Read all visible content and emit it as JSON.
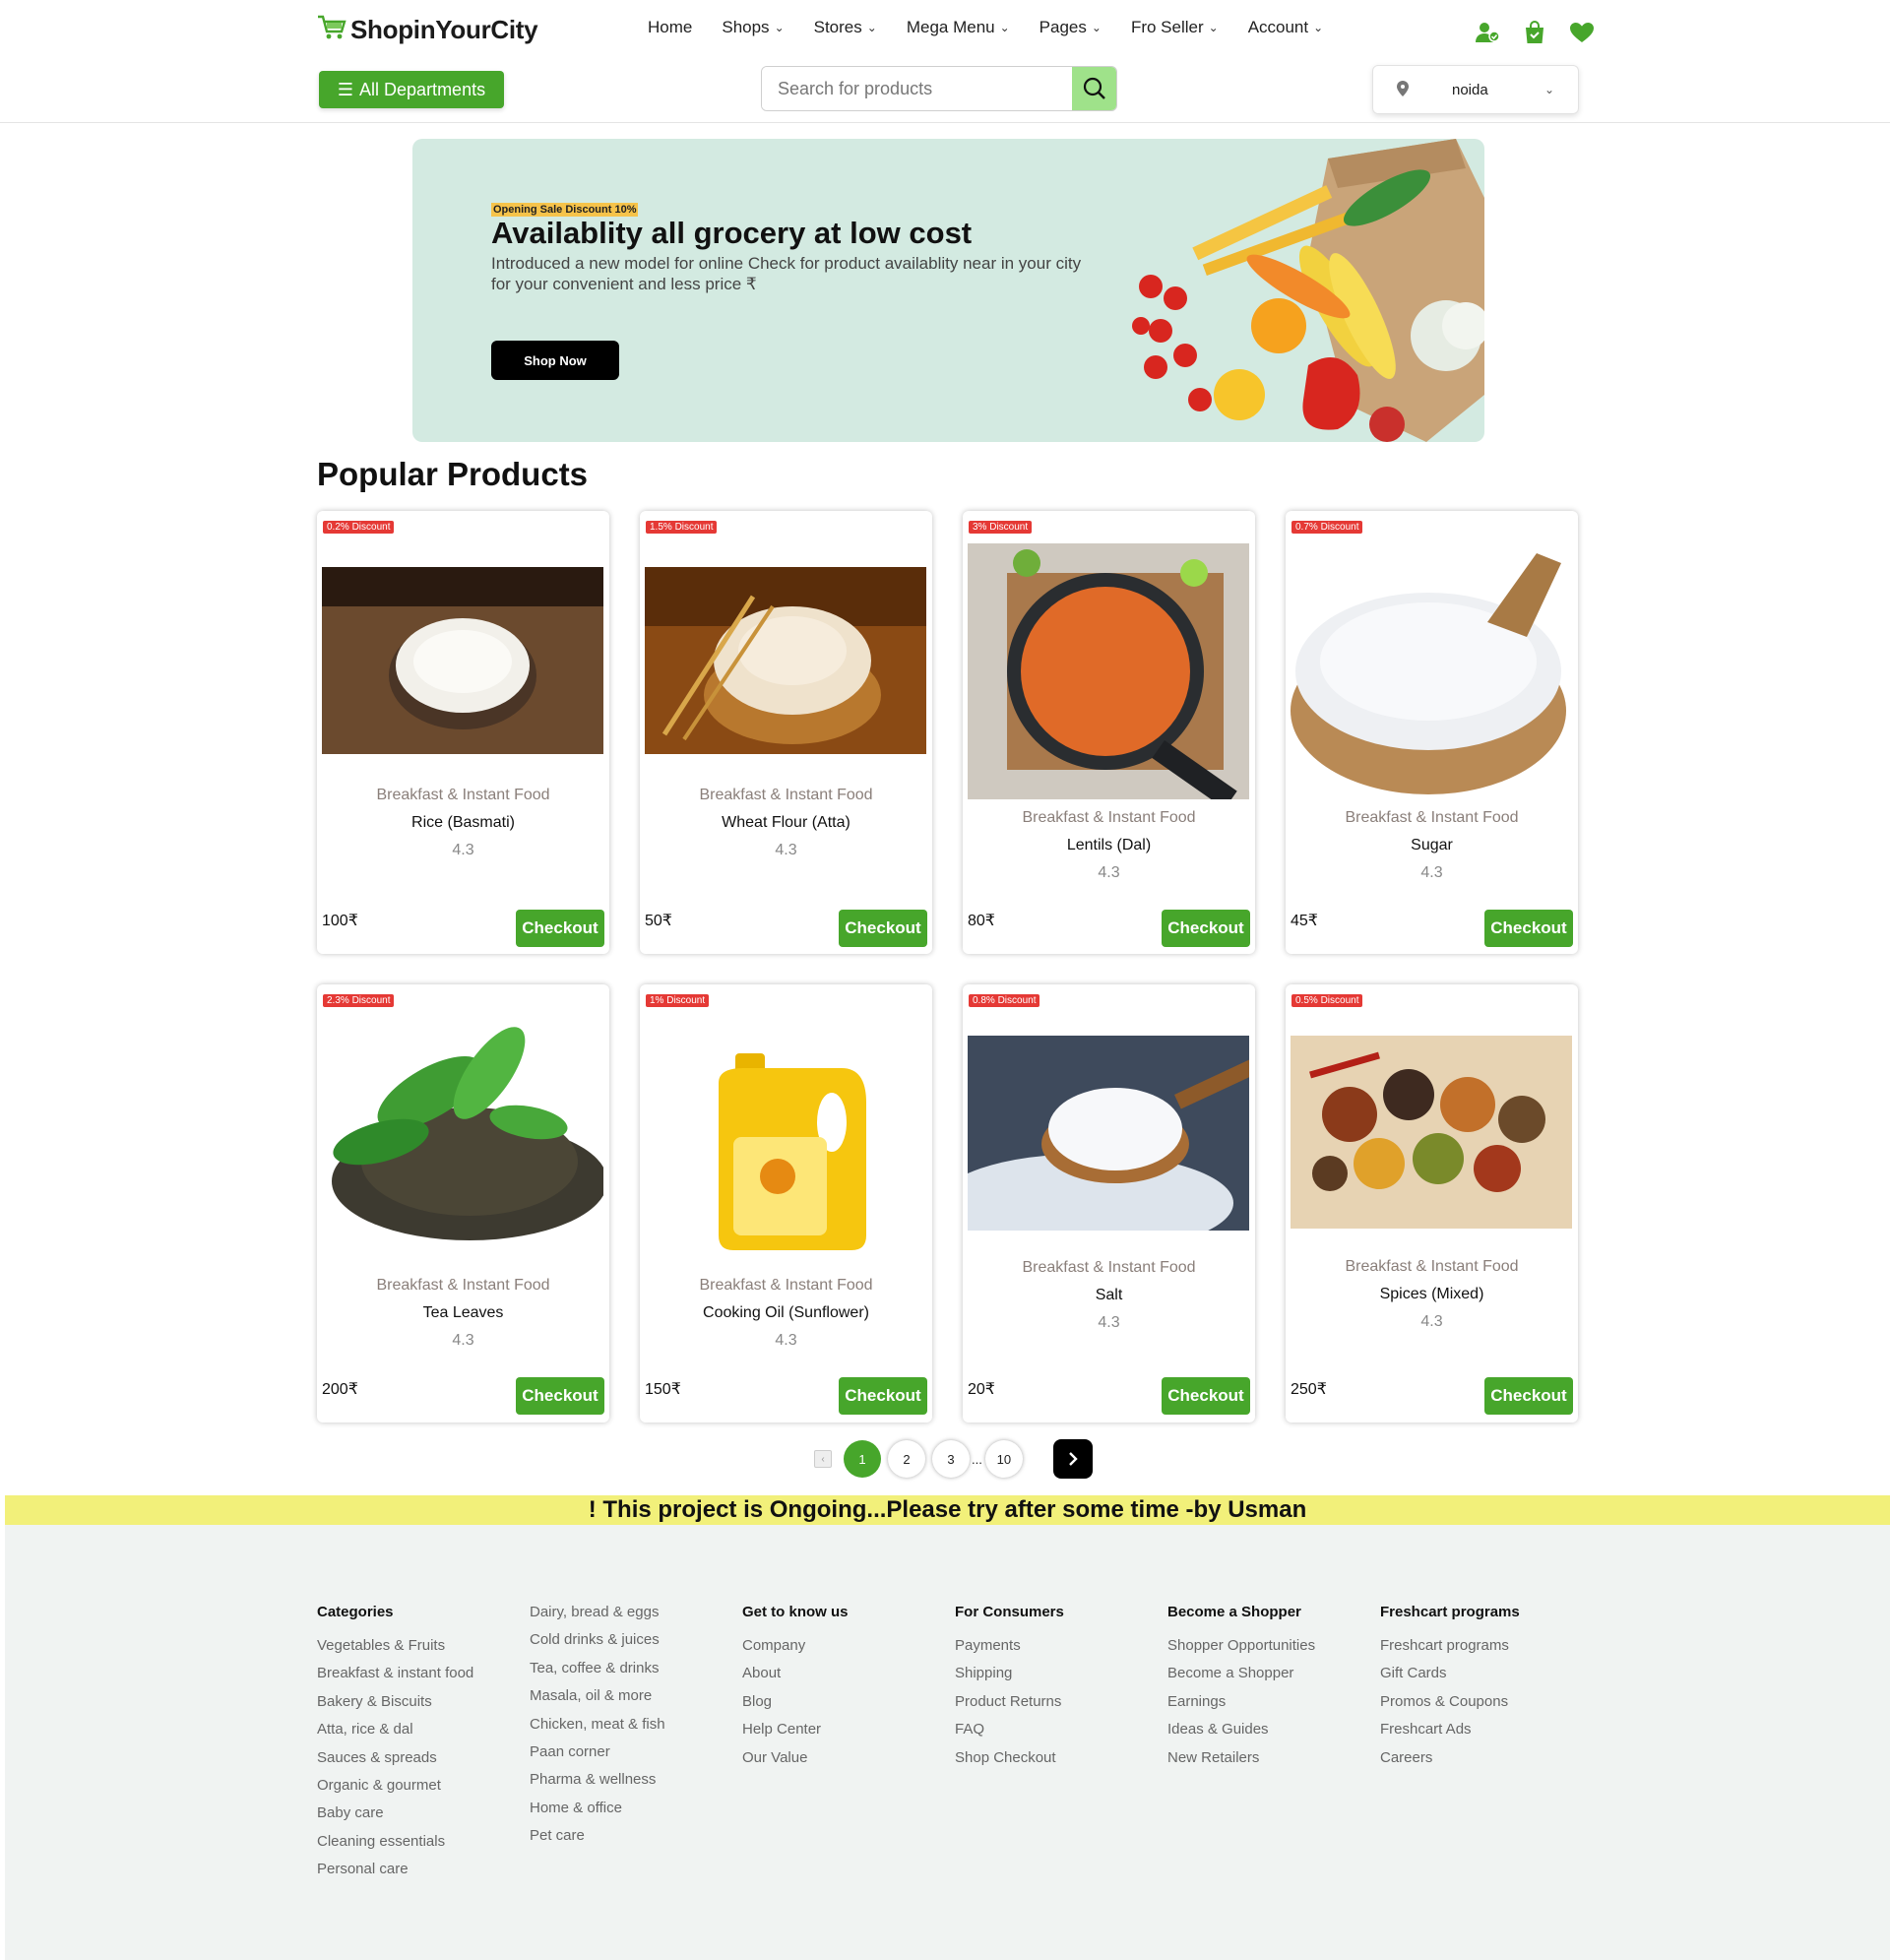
{
  "header": {
    "logo_text": "ShopinYourCity",
    "nav": [
      {
        "label": "Home",
        "has_dropdown": false
      },
      {
        "label": "Shops",
        "has_dropdown": true
      },
      {
        "label": "Stores",
        "has_dropdown": true
      },
      {
        "label": "Mega Menu",
        "has_dropdown": true
      },
      {
        "label": "Pages",
        "has_dropdown": true
      },
      {
        "label": "Fro Seller",
        "has_dropdown": true
      },
      {
        "label": "Account",
        "has_dropdown": true
      }
    ],
    "icons": [
      "user-icon",
      "shopping-bag-icon",
      "heart-icon"
    ],
    "departments_label": "All Departments",
    "search_placeholder": "Search for products",
    "location": "noida"
  },
  "banner": {
    "tag": "Opening Sale Discount 10%",
    "title": "Availablity all grocery at low cost",
    "description": "Introduced a new model for online Check for product availablity near in your city for your convenient and less price ₹",
    "button": "Shop Now"
  },
  "popular": {
    "title": "Popular Products",
    "checkout_label": "Checkout",
    "products": [
      {
        "discount": "0.2% Discount",
        "category": "Breakfast & Instant Food",
        "name": "Rice (Basmati)",
        "rating": "4.3",
        "price": "100₹"
      },
      {
        "discount": "1.5% Discount",
        "category": "Breakfast & Instant Food",
        "name": "Wheat Flour (Atta)",
        "rating": "4.3",
        "price": "50₹"
      },
      {
        "discount": "3% Discount",
        "category": "Breakfast & Instant Food",
        "name": "Lentils (Dal)",
        "rating": "4.3",
        "price": "80₹"
      },
      {
        "discount": "0.7% Discount",
        "category": "Breakfast & Instant Food",
        "name": "Sugar",
        "rating": "4.3",
        "price": "45₹"
      },
      {
        "discount": "2.3% Discount",
        "category": "Breakfast & Instant Food",
        "name": "Tea Leaves",
        "rating": "4.3",
        "price": "200₹"
      },
      {
        "discount": "1% Discount",
        "category": "Breakfast & Instant Food",
        "name": "Cooking Oil (Sunflower)",
        "rating": "4.3",
        "price": "150₹"
      },
      {
        "discount": "0.8% Discount",
        "category": "Breakfast & Instant Food",
        "name": "Salt",
        "rating": "4.3",
        "price": "20₹"
      },
      {
        "discount": "0.5% Discount",
        "category": "Breakfast & Instant Food",
        "name": "Spices (Mixed)",
        "rating": "4.3",
        "price": "250₹"
      }
    ]
  },
  "pagination": {
    "pages": [
      "1",
      "2",
      "3"
    ],
    "ellipsis": "...",
    "last": "10",
    "current": "1"
  },
  "notice": "! This project is Ongoing...Please try after some time -by Usman",
  "footer": {
    "columns": [
      {
        "title": "Categories",
        "links": [
          "Vegetables & Fruits",
          "Breakfast & instant food",
          "Bakery & Biscuits",
          "Atta, rice & dal",
          "Sauces & spreads",
          "Organic & gourmet",
          "Baby care",
          "Cleaning essentials",
          "Personal care"
        ]
      },
      {
        "title": "",
        "links": [
          "Dairy, bread & eggs",
          "Cold drinks & juices",
          "Tea, coffee & drinks",
          "Masala, oil & more",
          "Chicken, meat & fish",
          "Paan corner",
          "Pharma & wellness",
          "Home & office",
          "Pet care"
        ]
      },
      {
        "title": "Get to know us",
        "links": [
          "Company",
          "About",
          "Blog",
          "Help Center",
          "Our Value"
        ]
      },
      {
        "title": "For Consumers",
        "links": [
          "Payments",
          "Shipping",
          "Product Returns",
          "FAQ",
          "Shop Checkout"
        ]
      },
      {
        "title": "Become a Shopper",
        "links": [
          "Shopper Opportunities",
          "Become a Shopper",
          "Earnings",
          "Ideas & Guides",
          "New Retailers"
        ]
      },
      {
        "title": "Freshcart programs",
        "links": [
          "Freshcart programs",
          "Gift Cards",
          "Promos & Coupons",
          "Freshcart Ads",
          "Careers"
        ]
      }
    ]
  },
  "colors": {
    "brand_green": "#47a62b",
    "banner_bg": "#d3eae1",
    "discount_red": "#e53935",
    "notice_yellow": "#f2f07a",
    "footer_bg": "#f0f3f2"
  }
}
